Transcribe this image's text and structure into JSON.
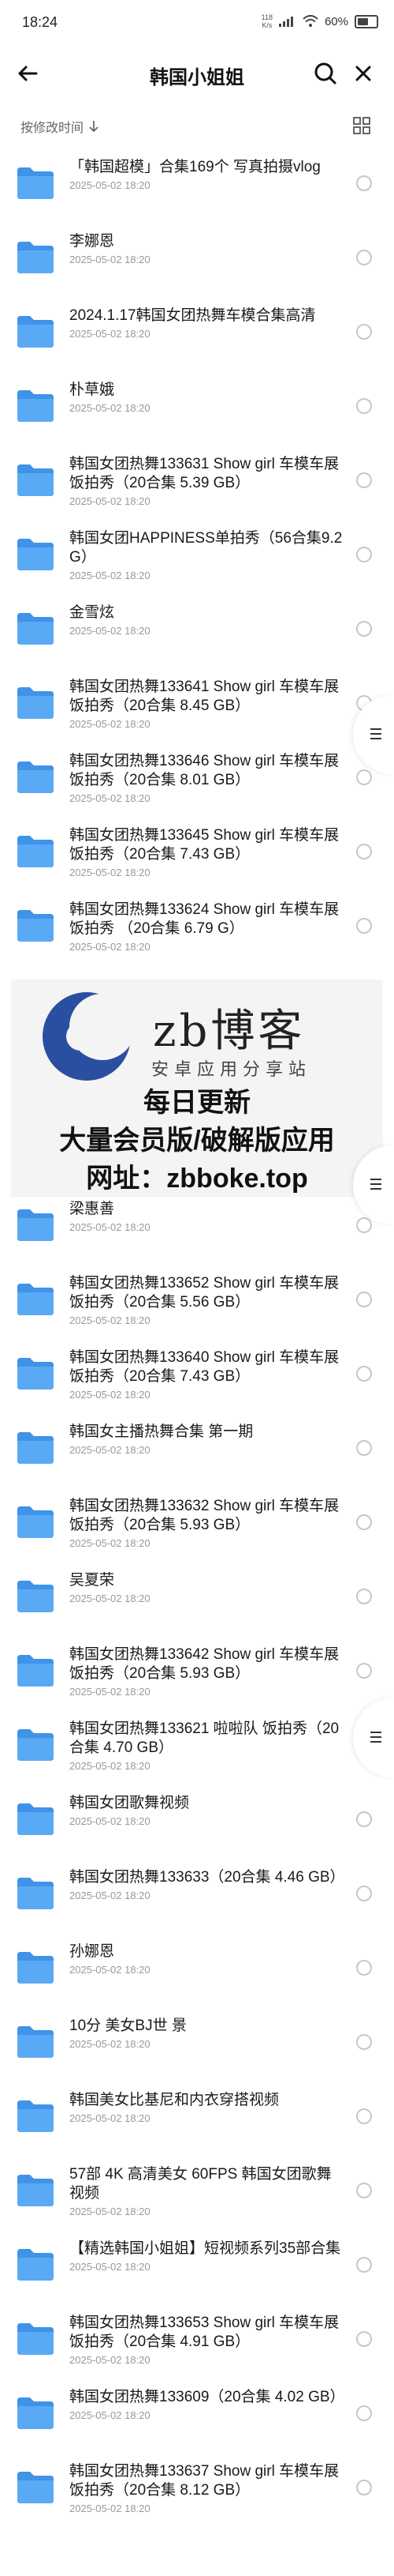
{
  "status": {
    "time": "18:24",
    "speed_top": "118",
    "speed_bottom": "K/s",
    "battery": "60%"
  },
  "header": {
    "title": "韩国小姐姐"
  },
  "sort": {
    "label": "按修改时间"
  },
  "items": [
    {
      "name": "「韩国超模」合集169个 写真拍摄vlog",
      "date": "2025-05-02 18:20"
    },
    {
      "name": "李娜恩",
      "date": "2025-05-02 18:20"
    },
    {
      "name": "2024.1.17韩国女团热舞车模合集高清",
      "date": "2025-05-02 18:20"
    },
    {
      "name": "朴草娥",
      "date": "2025-05-02 18:20"
    },
    {
      "name": "韩国女团热舞133631 Show girl 车模车展饭拍秀（20合集 5.39 GB）",
      "date": "2025-05-02 18:20"
    },
    {
      "name": "韩国女团HAPPINESS单拍秀（56合集9.2G）",
      "date": "2025-05-02 18:20"
    },
    {
      "name": "金雪炫",
      "date": "2025-05-02 18:20"
    },
    {
      "name": "韩国女团热舞133641 Show girl 车模车展饭拍秀（20合集 8.45 GB）",
      "date": "2025-05-02 18:20"
    },
    {
      "name": "韩国女团热舞133646 Show girl 车模车展饭拍秀（20合集 8.01 GB）",
      "date": "2025-05-02 18:20"
    },
    {
      "name": "韩国女团热舞133645 Show girl 车模车展饭拍秀（20合集 7.43 GB）",
      "date": "2025-05-02 18:20"
    },
    {
      "name": "韩国女团热舞133624 Show girl 车模车展饭拍秀 （20合集 6.79 G）",
      "date": "2025-05-02 18:20"
    },
    {
      "name": "梁惠善",
      "date": "2025-05-02 18:20"
    },
    {
      "name": "韩国女团热舞133652 Show girl 车模车展饭拍秀（20合集 5.56 GB）",
      "date": "2025-05-02 18:20"
    },
    {
      "name": "韩国女团热舞133640 Show girl 车模车展饭拍秀（20合集 7.43 GB）",
      "date": "2025-05-02 18:20"
    },
    {
      "name": "韩国女主播热舞合集 第一期",
      "date": "2025-05-02 18:20"
    },
    {
      "name": "韩国女团热舞133632 Show girl 车模车展饭拍秀（20合集 5.93 GB）",
      "date": "2025-05-02 18:20"
    },
    {
      "name": "吴夏荣",
      "date": "2025-05-02 18:20"
    },
    {
      "name": "韩国女团热舞133642 Show girl 车模车展饭拍秀（20合集 5.93 GB）",
      "date": "2025-05-02 18:20"
    },
    {
      "name": "韩国女团热舞133621 啦啦队 饭拍秀（20合集 4.70 GB）",
      "date": "2025-05-02 18:20"
    },
    {
      "name": "韩国女团歌舞视频",
      "date": "2025-05-02 18:20"
    },
    {
      "name": "韩国女团热舞133633（20合集 4.46 GB）",
      "date": "2025-05-02 18:20"
    },
    {
      "name": "孙娜恩",
      "date": "2025-05-02 18:20"
    },
    {
      "name": "10分 美女BJ世 景",
      "date": "2025-05-02 18:20"
    },
    {
      "name": "韩国美女比基尼和内衣穿搭视频",
      "date": "2025-05-02 18:20"
    },
    {
      "name": "57部 4K 高清美女 60FPS 韩国女团歌舞视频",
      "date": "2025-05-02 18:20"
    },
    {
      "name": "【精选韩国小姐姐】短视频系列35部合集",
      "date": "2025-05-02 18:20"
    },
    {
      "name": "韩国女团热舞133653 Show girl 车模车展饭拍秀（20合集 4.91 GB）",
      "date": "2025-05-02 18:20"
    },
    {
      "name": "韩国女团热舞133609（20合集 4.02 GB）",
      "date": "2025-05-02 18:20"
    },
    {
      "name": "韩国女团热舞133637 Show girl 车模车展饭拍秀（20合集 8.12 GB）",
      "date": "2025-05-02 18:20"
    }
  ],
  "ad": {
    "brand": "zb博客",
    "tagline": "安卓应用分享站",
    "line1": "每日更新",
    "line2": "大量会员版/破解版应用",
    "line3": "网址：zbboke.top"
  },
  "colors": {
    "folder": "#5aa9f5",
    "folder_dark": "#3f93e8",
    "accent": "#2b6fd6"
  }
}
